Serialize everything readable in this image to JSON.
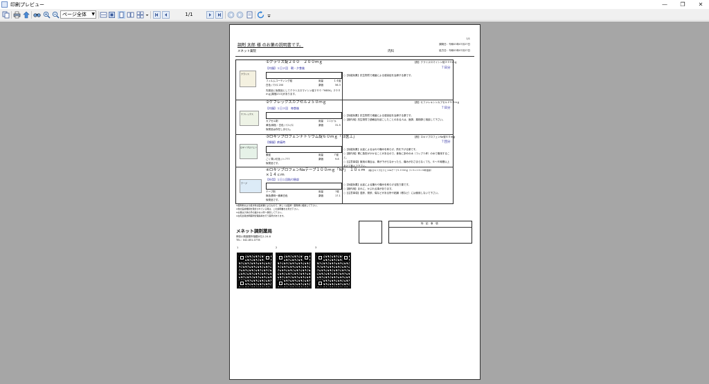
{
  "window": {
    "title": "印刷プレビュー",
    "controls": [
      "minimize-icon",
      "restore-icon",
      "close-icon"
    ]
  },
  "toolbar": {
    "zoom_value": "ページ全体",
    "page_indicator": "1/1",
    "icons": [
      "copy-icon",
      "print-icon",
      "export-icon",
      "find-icon",
      "zoom-in-icon",
      "zoom-out-icon",
      "one-page-icon",
      "multi-page-icon",
      "page-setup-icon",
      "first-page-icon",
      "prev-page-icon",
      "next-page-icon",
      "last-page-icon",
      "refresh-icon"
    ]
  },
  "document": {
    "page_no": "1/1",
    "heading": "調剤 太郎 様 のお薬の説明書です。",
    "pharmacy_short": "メネット薬院",
    "dept": "内科",
    "dispense_date": "調剤日：令和03年07月27日",
    "issue_date": "処方日：令和03年07月27日",
    "drugs": [
      {
        "name": "①クラリス錠２００　２００ｍｇ",
        "generic": "【般】クラリスロマイシン錠２００ｍｇ",
        "dosage": "【内服】１日２回　朝・夕食後",
        "days": "７日分",
        "form": "フィルムコーティング錠",
        "qty_label": "用量",
        "qty": "１４錠",
        "color": "白色 / ｸﾗﾘｽ 200",
        "price_label": "薬価",
        "price": "56.3",
        "note": "先発品と後発品としてクラリスロマイシン錠２００「MEEK」２００ｍｇ[薬価23.5]があります。",
        "effects": "○【効能効果】抗生物質で細菌による感染症を治療する薬です。",
        "img_label": "クラリス"
      },
      {
        "name": "②ケフレックスカプセル２５０ｍｇ",
        "generic": "【般】セファレキシンカプセル２５０ｍｇ",
        "dosage": "【内服】１日３回　毎食後",
        "days": "７日分",
        "form": "カプセル剤",
        "qty_label": "用量",
        "qty": "２１ｶﾌﾟｾﾙ",
        "color": "黄色/緑色・白色 / ｹﾌﾚｯｸｽ",
        "price_label": "薬価",
        "price": "31.5",
        "note": "後発品は存在しません。",
        "effects": "○【効能効果】抗生物質で細菌による感染症を治療する薬です。\n○【副作用】抗生物質で過敏症を起こしたことのある人は、医師、薬剤師と相談して下さい。",
        "img_label": "ケフレックス"
      },
      {
        "name": "③ロキソプロフェンナトリウム錠６０ｍｇ「日医工」",
        "generic": "【般】ロキソプロフェンNa錠６０ｍｇ",
        "dosage": "【頓服】疼痛時",
        "days": "７回分",
        "form": "素錠",
        "qty_label": "用量",
        "qty": "７錠",
        "color": "ごく薄い紅色 / n 777",
        "price_label": "薬価",
        "price": "9.8",
        "note": "後発品です。",
        "effects": "○【効能効果】炎症によるはれや痛みを和らげ、熱を下げる薬です。\n○【副作用】胃に負担がかかることがあるので、食後に多めの水（コップ１杯）の水で服用すること。\n○【注意事項】服用の場合は、胃が下がらなかったら、痛みがおさまらなくても、６～８時間以上あけて飲んで下さい。",
        "img_label": "ロキソプロフェン"
      },
      {
        "name": "④ロキソプロフェンNaテープ１００ｍｇ「NP」　１０ｃｍ×１４ｃｍ",
        "generic": "(般)ロキソプロフェンNaテープ１００ｍｇ（１０×１４ｃｍ非温感）",
        "dosage": "【外用】１日１回貼付患部",
        "days": "",
        "form": "テープ剤",
        "qty_label": "用量",
        "qty": "7枚",
        "color": "無色透明～微黄白色",
        "price_label": "薬価",
        "price": "17.1",
        "note": "後発品です。",
        "effects": "○【効能効果】炎症による腫れや痛みを和らげる貼り薬です。\n○【副作用】まれに、かぶれる事があります。\n○【注意事項】湿疹、発疹、傷などがある所や粘膜（眼など）には使用しないで下さい。",
        "img_label": "テープ"
      }
    ],
    "footnotes": [
      "※薬剤料および処方料は医療費によるもので、詳しくは医師・薬剤師に相談して下さい。",
      "※他の医療機関を受診されている時は、この説明書をお見せ下さい。",
      "※お薬は子供の手の届かない所へ保管して下さい。",
      "※在宅患者訪問薬剤管理指導を行う薬局があります。"
    ],
    "pharmacy_name": "メネット調剤薬局",
    "address": "神奈川県座間市相模が丘1-24-8",
    "tel": "TEL：042-851-0778",
    "special_notes_label": "特　記　事　項",
    "qr_labels": [
      "1",
      "2",
      "3"
    ]
  }
}
